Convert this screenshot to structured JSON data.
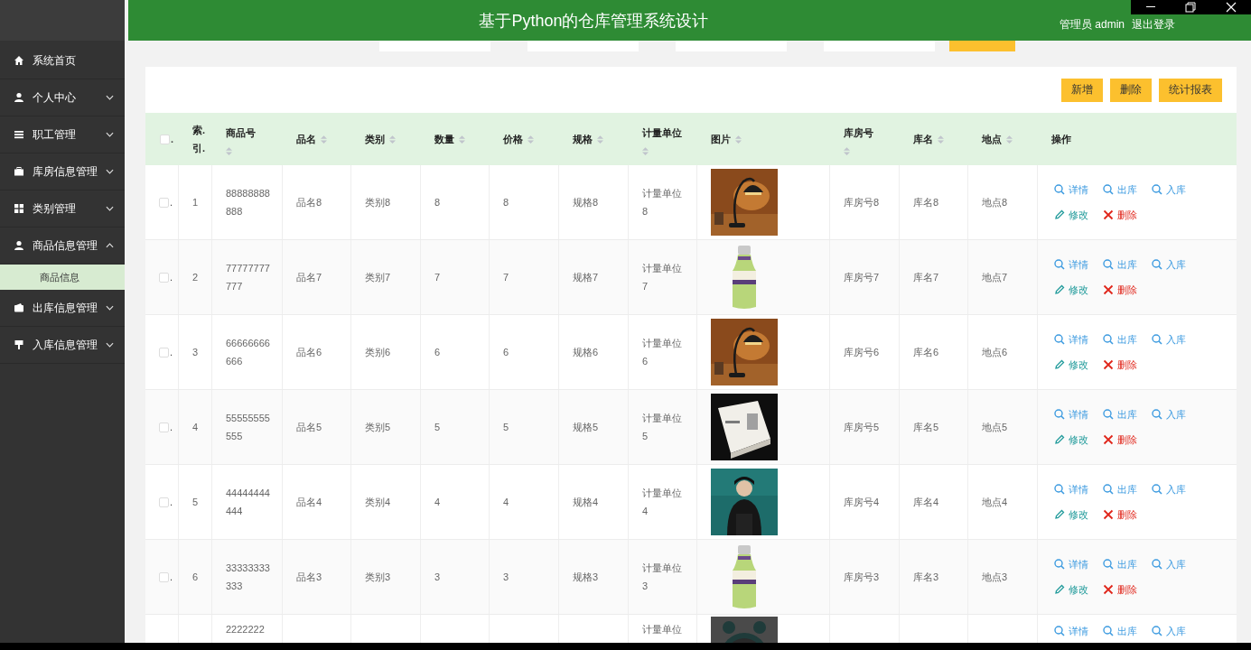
{
  "header": {
    "title": "基于Python的仓库管理系统设计",
    "user": "管理员 admin",
    "logout": "退出登录"
  },
  "sidebar": {
    "items": [
      {
        "label": "系统首页",
        "kind": "link"
      },
      {
        "label": "个人中心",
        "kind": "group",
        "expanded": false
      },
      {
        "label": "职工管理",
        "kind": "group",
        "expanded": false
      },
      {
        "label": "库房信息管理",
        "kind": "group",
        "expanded": false
      },
      {
        "label": "类别管理",
        "kind": "group",
        "expanded": false
      },
      {
        "label": "商品信息管理",
        "kind": "group",
        "expanded": true,
        "children": [
          {
            "label": "商品信息",
            "selected": true
          }
        ]
      },
      {
        "label": "出库信息管理",
        "kind": "group",
        "expanded": false
      },
      {
        "label": "入库信息管理",
        "kind": "group",
        "expanded": false
      }
    ]
  },
  "toolbar": {
    "buttons": [
      "新增",
      "删除",
      "统计报表"
    ]
  },
  "table": {
    "select_all": {
      "checked": false,
      "mark": "."
    },
    "columns": [
      {
        "label": "索.引.",
        "sortable": false
      },
      {
        "label": "商品号",
        "sortable": true
      },
      {
        "label": "品名",
        "sortable": true
      },
      {
        "label": "类别",
        "sortable": true
      },
      {
        "label": "数量",
        "sortable": true
      },
      {
        "label": "价格",
        "sortable": true
      },
      {
        "label": "规格",
        "sortable": true
      },
      {
        "label": "计量单位",
        "sortable": true
      },
      {
        "label": "图片",
        "sortable": true
      },
      {
        "label": "库房号",
        "sortable": true
      },
      {
        "label": "库名",
        "sortable": true
      },
      {
        "label": "地点",
        "sortable": true
      },
      {
        "label": "操作",
        "sortable": false
      }
    ],
    "rows": [
      {
        "checked": false,
        "mark": ".",
        "partial": false,
        "cells": [
          "1",
          "88888888888",
          "品名8",
          "类别8",
          "8",
          "8",
          "规格8",
          "计量单位8",
          "",
          "库房号8",
          "库名8",
          "地点8"
        ],
        "actions": [
          {
            "label": "详情",
            "kind": "search"
          },
          {
            "label": "出库",
            "kind": "search"
          },
          {
            "label": "入库",
            "kind": "search"
          },
          {
            "label": "修改",
            "kind": "edit"
          },
          {
            "label": "删除",
            "kind": "delete"
          }
        ]
      },
      {
        "checked": false,
        "mark": ".",
        "partial": false,
        "cells": [
          "2",
          "77777777777",
          "品名7",
          "类别7",
          "7",
          "7",
          "规格7",
          "计量单位7",
          "",
          "库房号7",
          "库名7",
          "地点7"
        ],
        "actions": [
          {
            "label": "详情",
            "kind": "search"
          },
          {
            "label": "出库",
            "kind": "search"
          },
          {
            "label": "入库",
            "kind": "search"
          },
          {
            "label": "修改",
            "kind": "edit"
          },
          {
            "label": "删除",
            "kind": "delete"
          }
        ]
      },
      {
        "checked": false,
        "mark": ".",
        "partial": false,
        "cells": [
          "3",
          "66666666666",
          "品名6",
          "类别6",
          "6",
          "6",
          "规格6",
          "计量单位6",
          "",
          "库房号6",
          "库名6",
          "地点6"
        ],
        "actions": [
          {
            "label": "详情",
            "kind": "search"
          },
          {
            "label": "出库",
            "kind": "search"
          },
          {
            "label": "入库",
            "kind": "search"
          },
          {
            "label": "修改",
            "kind": "edit"
          },
          {
            "label": "删除",
            "kind": "delete"
          }
        ]
      },
      {
        "checked": false,
        "mark": ".",
        "partial": false,
        "cells": [
          "4",
          "55555555555",
          "品名5",
          "类别5",
          "5",
          "5",
          "规格5",
          "计量单位5",
          "",
          "库房号5",
          "库名5",
          "地点5"
        ],
        "actions": [
          {
            "label": "详情",
            "kind": "search"
          },
          {
            "label": "出库",
            "kind": "search"
          },
          {
            "label": "入库",
            "kind": "search"
          },
          {
            "label": "修改",
            "kind": "edit"
          },
          {
            "label": "删除",
            "kind": "delete"
          }
        ]
      },
      {
        "checked": false,
        "mark": ".",
        "partial": false,
        "cells": [
          "5",
          "44444444444",
          "品名4",
          "类别4",
          "4",
          "4",
          "规格4",
          "计量单位4",
          "",
          "库房号4",
          "库名4",
          "地点4"
        ],
        "actions": [
          {
            "label": "详情",
            "kind": "search"
          },
          {
            "label": "出库",
            "kind": "search"
          },
          {
            "label": "入库",
            "kind": "search"
          },
          {
            "label": "修改",
            "kind": "edit"
          },
          {
            "label": "删除",
            "kind": "delete"
          }
        ]
      },
      {
        "checked": false,
        "mark": ".",
        "partial": false,
        "cells": [
          "6",
          "33333333333",
          "品名3",
          "类别3",
          "3",
          "3",
          "规格3",
          "计量单位3",
          "",
          "库房号3",
          "库名3",
          "地点3"
        ],
        "actions": [
          {
            "label": "详情",
            "kind": "search"
          },
          {
            "label": "出库",
            "kind": "search"
          },
          {
            "label": "入库",
            "kind": "search"
          },
          {
            "label": "修改",
            "kind": "edit"
          },
          {
            "label": "删除",
            "kind": "delete"
          }
        ]
      },
      {
        "partial": true,
        "cells": [
          "",
          "2222222",
          "",
          "",
          "",
          "",
          "",
          "计量单位",
          "",
          "",
          "",
          ""
        ],
        "actions": [
          {
            "label": "详情",
            "kind": "search"
          },
          {
            "label": "出库",
            "kind": "search"
          },
          {
            "label": "入库",
            "kind": "search"
          }
        ]
      }
    ]
  }
}
